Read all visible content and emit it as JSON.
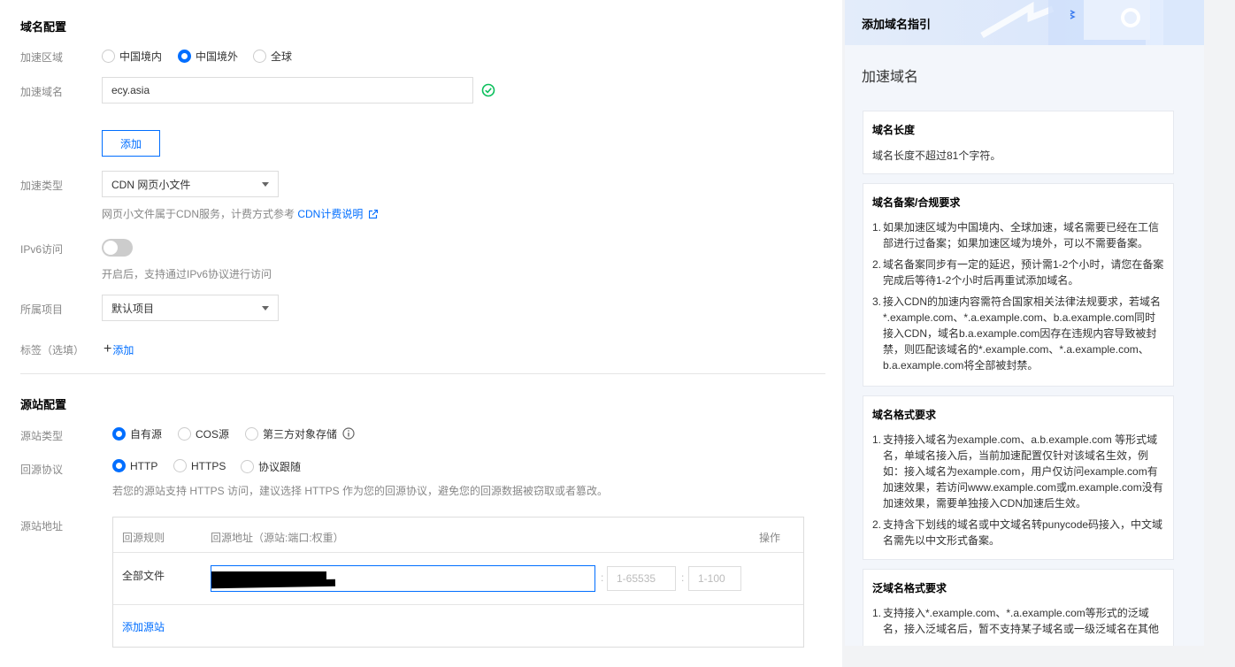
{
  "domain_config": {
    "title": "域名配置",
    "region_label": "加速区域",
    "region_options": [
      "中国境内",
      "中国境外",
      "全球"
    ],
    "region_selected": 1,
    "domain_label": "加速域名",
    "domain_value": "ecy.asia",
    "add_button": "添加",
    "type_label": "加速类型",
    "type_value": "CDN 网页小文件",
    "type_hint": "网页小文件属于CDN服务，计费方式参考",
    "type_hint_link": "CDN计费说明",
    "ipv6_label": "IPv6访问",
    "ipv6_hint": "开启后，支持通过IPv6协议进行访问",
    "project_label": "所属项目",
    "project_value": "默认项目",
    "tag_label": "标签（选填）",
    "tag_add": "添加"
  },
  "origin_config": {
    "title": "源站配置",
    "type_label": "源站类型",
    "type_options": [
      "自有源",
      "COS源",
      "第三方对象存储"
    ],
    "type_selected": 0,
    "protocol_label": "回源协议",
    "protocol_options": [
      "HTTP",
      "HTTPS",
      "协议跟随"
    ],
    "protocol_selected": 0,
    "protocol_hint": "若您的源站支持 HTTPS 访问，建议选择 HTTPS 作为您的回源协议，避免您的回源数据被窃取或者篡改。",
    "address_label": "源站地址",
    "table": {
      "headers": [
        "回源规则",
        "回源地址（源站:端口:权重）",
        "操作"
      ],
      "row_rule": "全部文件",
      "port_placeholder": "1-65535",
      "weight_placeholder": "1-100",
      "add_origin": "添加源站"
    }
  },
  "guide": {
    "header": "添加域名指引",
    "title": "加速域名",
    "cards": {
      "length_title": "域名长度",
      "length_text": "域名长度不超过81个字符。",
      "icp_title": "域名备案/合规要求",
      "icp_items": [
        "如果加速区域为中国境内、全球加速，域名需要已经在工信部进行过备案；如果加速区域为境外，可以不需要备案。",
        "域名备案同步有一定的延迟，预计需1-2个小时，请您在备案完成后等待1-2个小时后再重试添加域名。",
        "接入CDN的加速内容需符合国家相关法律法规要求，若域名*.example.com、*.a.example.com、b.a.example.com同时接入CDN，域名b.a.example.com因存在违规内容导致被封禁，则匹配该域名的*.example.com、*.a.example.com、b.a.example.com将全部被封禁。"
      ],
      "format_title": "域名格式要求",
      "format_items": [
        "支持接入域名为example.com、a.b.example.com 等形式域名，单域名接入后，当前加速配置仅针对该域名生效，例如：接入域名为example.com，用户仅访问example.com有加速效果，若访问www.example.com或m.example.com没有加速效果，需要单独接入CDN加速后生效。",
        "支持含下划线的域名或中文域名转punycode码接入，中文域名需先以中文形式备案。"
      ],
      "wildcard_title": "泛域名格式要求",
      "wildcard_items": [
        "支持接入*.example.com、*.a.example.com等形式的泛域名，接入泛域名后，暂不支持某子域名或一级泛域名在其他"
      ]
    }
  },
  "colors": {
    "accent": "#006eff",
    "success": "#0abf5b"
  }
}
